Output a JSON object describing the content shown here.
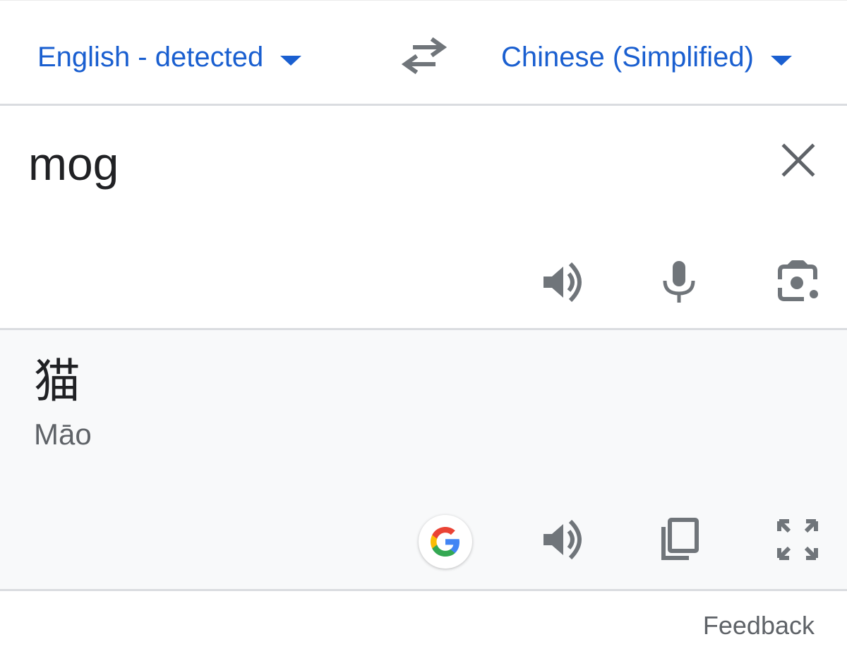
{
  "language_bar": {
    "source_language": "English - detected",
    "target_language": "Chinese (Simplified)",
    "swap_icon": "swap-arrows-icon",
    "dropdown_icon": "caret-down-icon"
  },
  "input": {
    "text": "mog",
    "clear_icon": "close-icon",
    "actions": [
      "speaker-icon",
      "microphone-icon",
      "camera-lens-icon"
    ]
  },
  "output": {
    "translation": "猫",
    "romanization": "Māo",
    "actions": [
      "google-g-icon",
      "speaker-icon",
      "copy-icon",
      "fullscreen-icon"
    ]
  },
  "footer": {
    "feedback_label": "Feedback"
  },
  "colors": {
    "accent": "#1a5fd0",
    "icon_gray": "#70757a",
    "output_bg": "#f8f9fa",
    "divider": "#dadce0"
  }
}
